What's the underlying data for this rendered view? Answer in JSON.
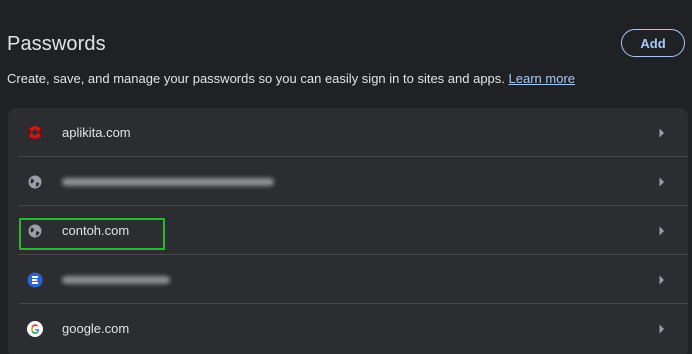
{
  "header": {
    "title": "Passwords",
    "add_label": "Add",
    "description": "Create, save, and manage your passwords so you can easily sign in to sites and apps.",
    "learn_more": "Learn more"
  },
  "colors": {
    "accent": "#a8c7fa",
    "highlight": "#27b82b",
    "background": "#202124",
    "card": "#2c2d30"
  },
  "password_list": [
    {
      "site": "aplikita.com",
      "icon": "aplikita-favicon",
      "blurred": false
    },
    {
      "site": "",
      "icon": "globe-icon",
      "blurred": true
    },
    {
      "site": "contoh.com",
      "icon": "globe-icon",
      "blurred": false,
      "highlighted": true
    },
    {
      "site": "",
      "icon": "blue-app-favicon",
      "blurred": true
    },
    {
      "site": "google.com",
      "icon": "google-icon",
      "blurred": false
    }
  ]
}
